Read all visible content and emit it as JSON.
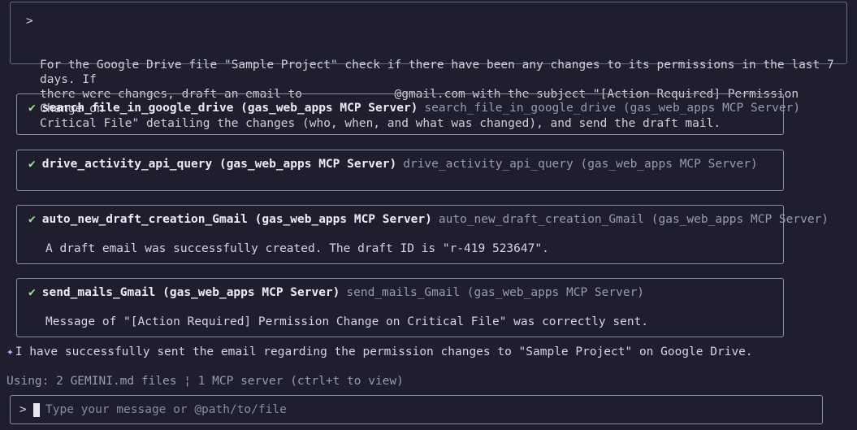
{
  "prompt": {
    "caret": ">",
    "text": "For the Google Drive file \"Sample Project\" check if there have been any changes to its permissions in the last 7 days. If\nthere were changes, draft an email to             @gmail.com with the subject \"[Action Required] Permission Change on\nCritical File\" detailing the changes (who, when, and what was changed), and send the draft mail."
  },
  "tool_calls": [
    {
      "status_icon": "✔",
      "name": "search_file_in_google_drive (gas_web_apps MCP Server)",
      "description": "search_file_in_google_drive (gas_web_apps MCP Server)",
      "result": ""
    },
    {
      "status_icon": "✔",
      "name": "drive_activity_api_query (gas_web_apps MCP Server)",
      "description": "drive_activity_api_query (gas_web_apps MCP Server)",
      "result": ""
    },
    {
      "status_icon": "✔",
      "name": "auto_new_draft_creation_Gmail (gas_web_apps MCP Server)",
      "description": "auto_new_draft_creation_Gmail (gas_web_apps MCP Server)",
      "result": "A draft email was successfully created. The draft ID is \"r-419          523647\"."
    },
    {
      "status_icon": "✔",
      "name": "send_mails_Gmail (gas_web_apps MCP Server)",
      "description": "send_mails_Gmail (gas_web_apps MCP Server)",
      "result": "Message of \"[Action Required] Permission Change on Critical File\" was correctly sent."
    }
  ],
  "final_message": {
    "icon": "✦",
    "text": "I have successfully sent the email regarding the permission changes to \"Sample Project\" on Google Drive."
  },
  "status_line": "Using: 2 GEMINI.md files ¦ 1 MCP server (ctrl+t to view)",
  "input": {
    "caret": ">",
    "placeholder": "Type your message or @path/to/file"
  }
}
